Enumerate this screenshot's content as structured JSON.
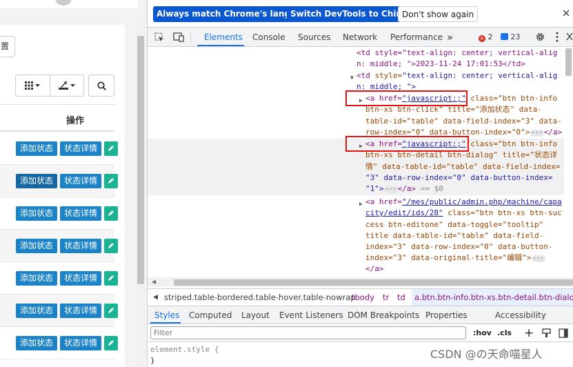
{
  "page": {
    "left_button": "置",
    "table_header_op": "操作",
    "rows": [
      {
        "add": "添加状态",
        "detail": "状态详情"
      },
      {
        "add": "添加状态",
        "detail": "状态详情"
      },
      {
        "add": "添加状态",
        "detail": "状态详情"
      },
      {
        "add": "添加状态",
        "detail": "状态详情"
      },
      {
        "add": "添加状态",
        "detail": "状态详情"
      },
      {
        "add": "添加状态",
        "detail": "状态详情"
      },
      {
        "add": "添加状态",
        "detail": "状态详情"
      }
    ]
  },
  "infobar": {
    "match_language": "Always match Chrome's language",
    "switch_chinese": "Switch DevTools to Chinese",
    "dont_show": "Don't show again"
  },
  "tabs": {
    "elements": "Elements",
    "console": "Console",
    "sources": "Sources",
    "network": "Network",
    "performance": "Performance",
    "more": "»",
    "errors": "2",
    "messages": "23"
  },
  "dom": {
    "l1a": "<td style=\"text-align: center; vertical-alig",
    "l1b": "n: middle; \">2023-11-24 17:01:53</td>",
    "l2_tag": "<td",
    "l2_attr": " style=",
    "l2_val": "\"text-align: center; vertical-alig",
    "l3": "n: middle; \">",
    "a1_open": "<a href=",
    "a1_href": "\"javascript:;\"",
    "a1_rest": " class=\"btn btn-info",
    "a1_l2": "btn-xs btn-click\" title=\"添加状态\" data-",
    "a1_l3": "table-id=\"table\" data-field-index=\"3\" data-",
    "a1_l4": "row-index=\"0\" data-button-index=\"0\">",
    "a1_close": "</a>",
    "a2_open": "<a href=",
    "a2_href": "\"javascript:;\"",
    "a2_rest": " class=\"btn btn-info",
    "a2_l2": "btn-xs btn-detail btn-dialog\" title=\"状态详",
    "a2_l3": "情\" data-table-id=\"table\" data-field-index=",
    "a2_l4": "\"3\" data-row-index=\"0\" data-button-index=",
    "a2_l5": "\"1\">",
    "a2_close": "</a>",
    "a2_eq": " == $0",
    "a3_open": "<a href=",
    "a3_href1": "\"/mes/public/admin.php/machine/capa",
    "a3_href2": "city/edit/ids/28\"",
    "a3_l2rest": " class=\"btn btn-xs btn-suc",
    "a3_l3": "cess btn-editone\" data-toggle=\"tooltip\"",
    "a3_l4": "title data-table-id=\"table\" data-field-",
    "a3_l5": "index=\"3\" data-row-index=\"0\" data-button-",
    "a3_l6": "index=\"3\" data-original-title=\"编辑\">",
    "a3_close": "</a>"
  },
  "breadcrumb": {
    "b1": "striped.table-bordered.table-hover.table-nowrap",
    "b2": "tbody",
    "b3": "tr",
    "b4": "td",
    "b5": "a.btn.btn-info.btn-xs.btn-detail.btn-dialog"
  },
  "subtabs": {
    "styles": "Styles",
    "computed": "Computed",
    "layout": "Layout",
    "listeners": "Event Listeners",
    "dom_bp": "DOM Breakpoints",
    "properties": "Properties",
    "accessibility": "Accessibility"
  },
  "filter": {
    "placeholder": "Filter",
    "hov": ":hov",
    "cls": ".cls",
    "plus": "+"
  },
  "style_rule": {
    "selector": "element.style {",
    "close": "}"
  },
  "watermark": "CSDN @の天命喵星人"
}
